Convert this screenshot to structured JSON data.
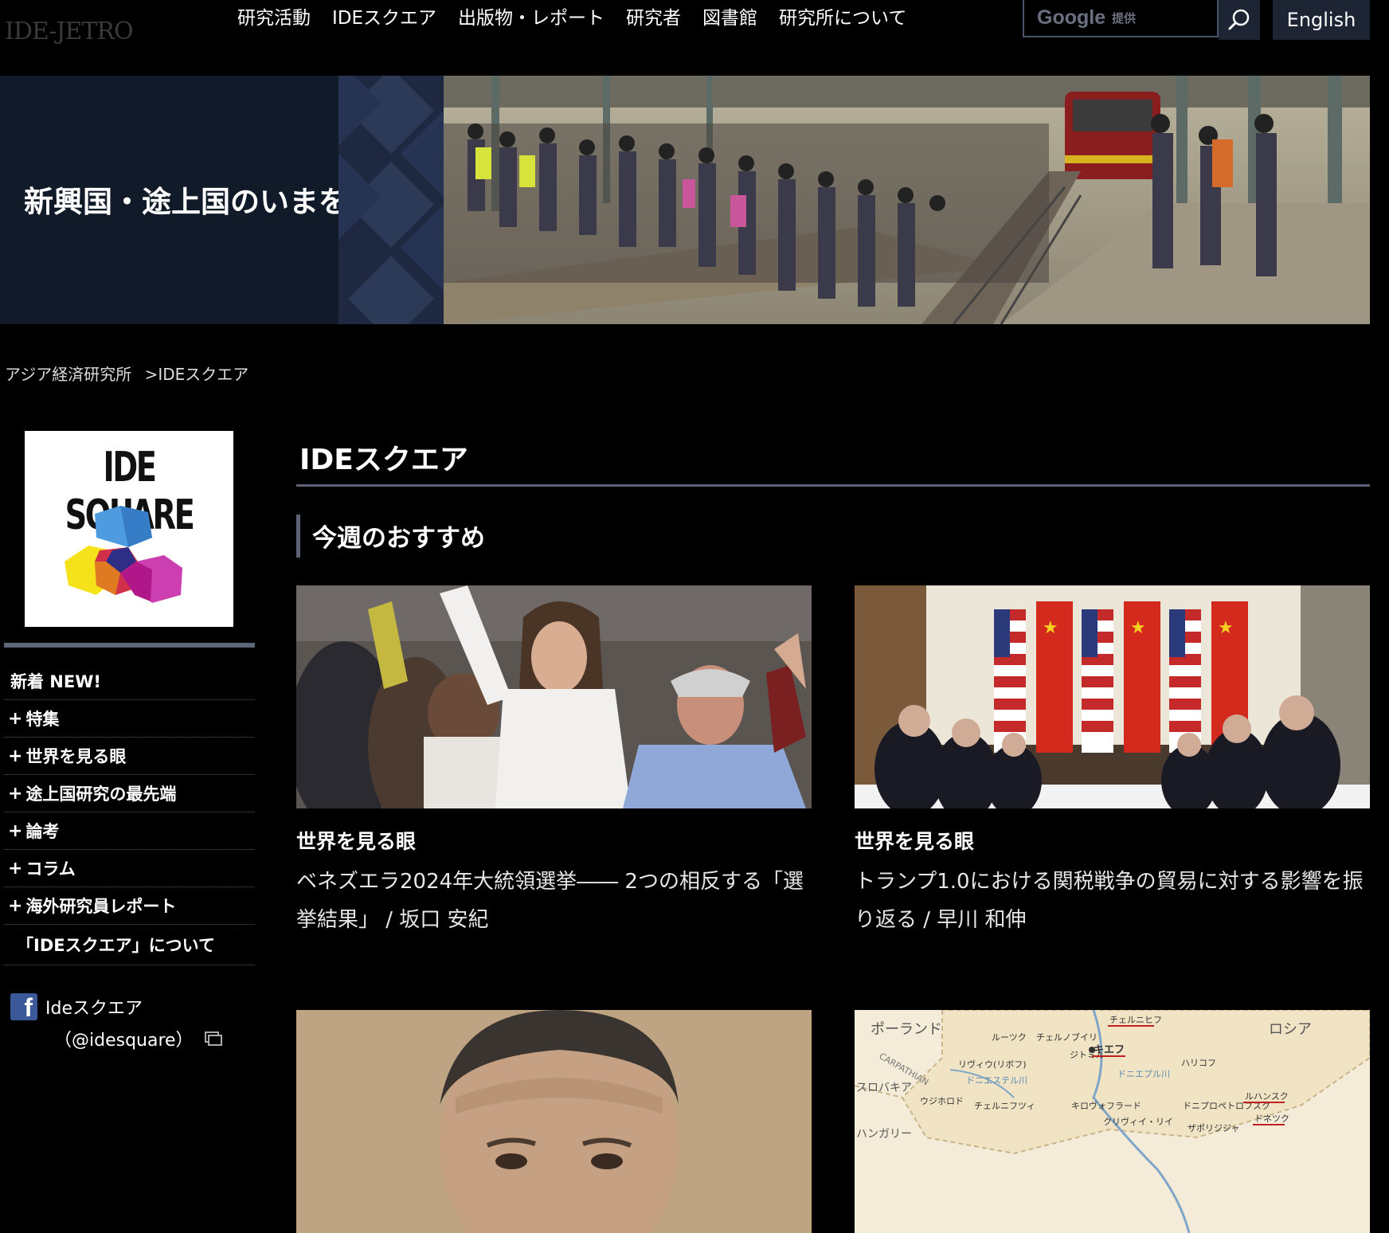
{
  "header": {
    "logo": "IDE-JETRO",
    "nav": [
      "研究活動",
      "IDEスクエア",
      "出版物・レポート",
      "研究者",
      "図書館",
      "研究所について"
    ],
    "search": {
      "brand": "Google",
      "provided": "提供"
    },
    "language_button": "English"
  },
  "hero": {
    "title": "新興国・途上国のいまを知る"
  },
  "breadcrumb": {
    "home": "アジア経済研究所",
    "separator": ">",
    "current": "IDEスクエア"
  },
  "sidebar": {
    "logo_text": "IDE SQUARE",
    "new_item": "新着 NEW!",
    "items": [
      "特集",
      "世界を見る眼",
      "途上国研究の最先端",
      "論考",
      "コラム",
      "海外研究員レポート"
    ],
    "about": "「IDEスクエア」について",
    "facebook": {
      "label": "Ideスクエア",
      "handle": "（@idesquare）"
    }
  },
  "main": {
    "title": "IDEスクエア",
    "section_title": "今週のおすすめ",
    "cards": [
      {
        "category": "世界を見る眼",
        "title": "ベネズエラ2024年大統領選挙―― 2つの相反する「選挙結果」 / 坂口 安紀"
      },
      {
        "category": "世界を見る眼",
        "title": "トランプ1.0における関税戦争の貿易に対する影響を振り返る / 早川 和伸"
      },
      {
        "category": "",
        "title": ""
      },
      {
        "category": "",
        "title": "",
        "map_labels": [
          "ポーランド",
          "ロシア",
          "スロバキア",
          "ハンガリー",
          "ルーツク",
          "チェルノブイリ",
          "チェルニヒフ",
          "ジトミル",
          "キエフ",
          "ハリコフ",
          "リヴィウ(リボフ)",
          "ドニエステル川",
          "ドニエプル川",
          "ウジホロド",
          "チェルニフツィ",
          "キロヴォフラード",
          "ドニプロペトロフスク",
          "ルハンスク",
          "ドネツク",
          "クリヴィイ・リイ",
          "ザポリジジャ",
          "CARPATHIAN"
        ]
      }
    ]
  },
  "colors": {
    "background": "#000000",
    "nav_button": "#1d2433",
    "hero_bg": "#111a28",
    "accent_rule": "#5d6275"
  }
}
